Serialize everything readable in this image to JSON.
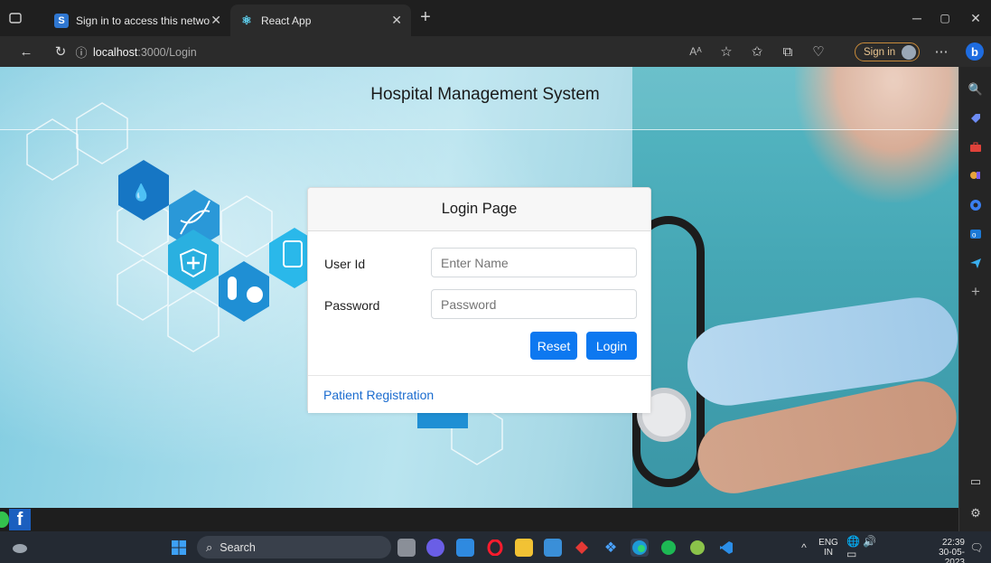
{
  "browser": {
    "tabs": [
      {
        "label": "Sign in to access this network",
        "favicon": "S",
        "favicon_color": "#2f77d1"
      },
      {
        "label": "React App",
        "favicon": "⚛",
        "favicon_color": "#61dafb"
      }
    ],
    "address": {
      "host": "localhost",
      "path": ":3000/Login"
    },
    "signin_label": "Sign in",
    "read_aloud_icon": "Aᴬ"
  },
  "page": {
    "title": "Hospital Management System",
    "login": {
      "heading": "Login Page",
      "user_label": "User Id",
      "user_placeholder": "Enter Name",
      "password_label": "Password",
      "password_placeholder": "Password",
      "reset_label": "Reset",
      "login_label": "Login",
      "registration_link": "Patient Registration"
    }
  },
  "taskbar": {
    "search_label": "Search",
    "language": "ENG",
    "region": "IN",
    "time": "22:39",
    "date": "30-05-2023"
  },
  "colors": {
    "primary_button": "#0d78f0",
    "link": "#1b6ccf",
    "signin_accent": "#c98b3a"
  }
}
